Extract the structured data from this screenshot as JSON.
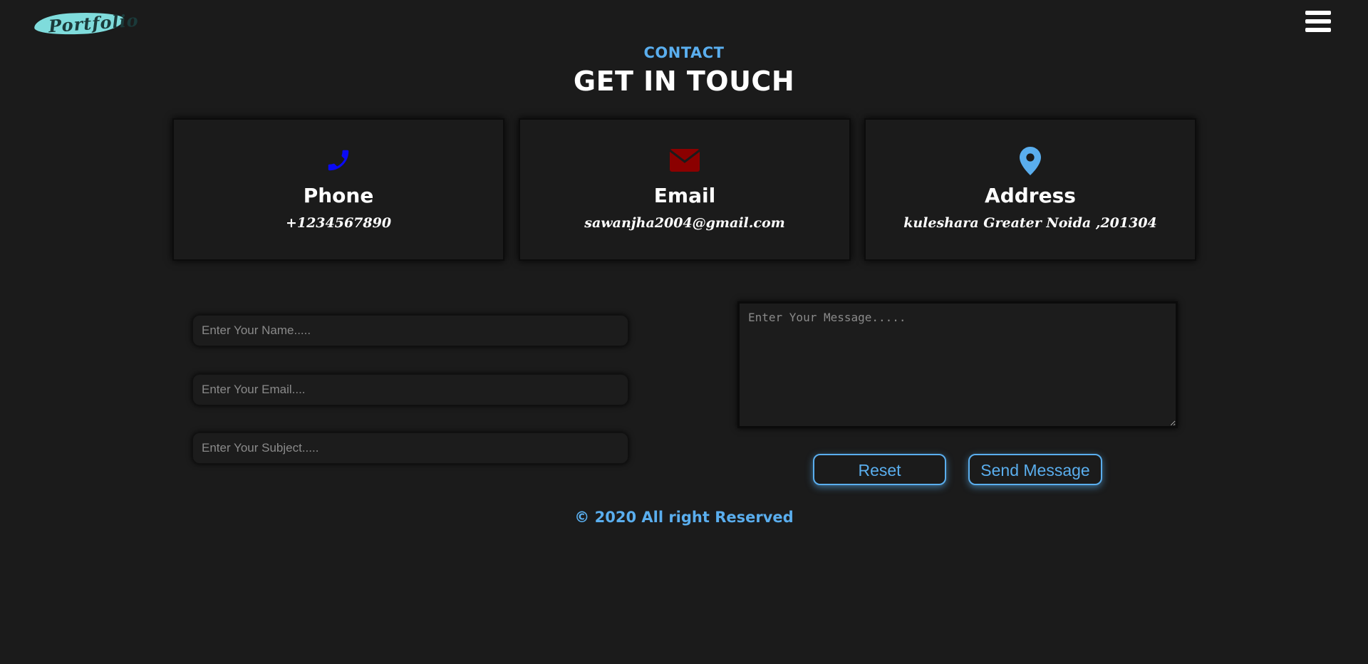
{
  "header": {
    "logo_text": "Portfolio",
    "menu_icon": "hamburger-icon"
  },
  "section": {
    "eyebrow": "CONTACT",
    "title": "GET IN TOUCH"
  },
  "cards": [
    {
      "icon": "phone-icon",
      "icon_color": "#0a0af5",
      "label": "Phone",
      "value": "+1234567890"
    },
    {
      "icon": "envelope-icon",
      "icon_color": "#8b0000",
      "label": "Email",
      "value": "sawanjha2004@gmail.com"
    },
    {
      "icon": "map-marker-icon",
      "icon_color": "#5aaeee",
      "label": "Address",
      "value": "kuleshara Greater Noida ,201304"
    }
  ],
  "form": {
    "name_placeholder": "Enter Your Name.....",
    "email_placeholder": "Enter Your Email....",
    "subject_placeholder": "Enter Your Subject.....",
    "message_placeholder": "Enter Your Message.....",
    "reset_label": "Reset",
    "send_label": "Send Message"
  },
  "footer": {
    "copyright": "© 2020 All right Reserved"
  },
  "colors": {
    "background": "#1b1b1b",
    "accent": "#5aaeee",
    "logo_brush": "#7fdcdc"
  }
}
